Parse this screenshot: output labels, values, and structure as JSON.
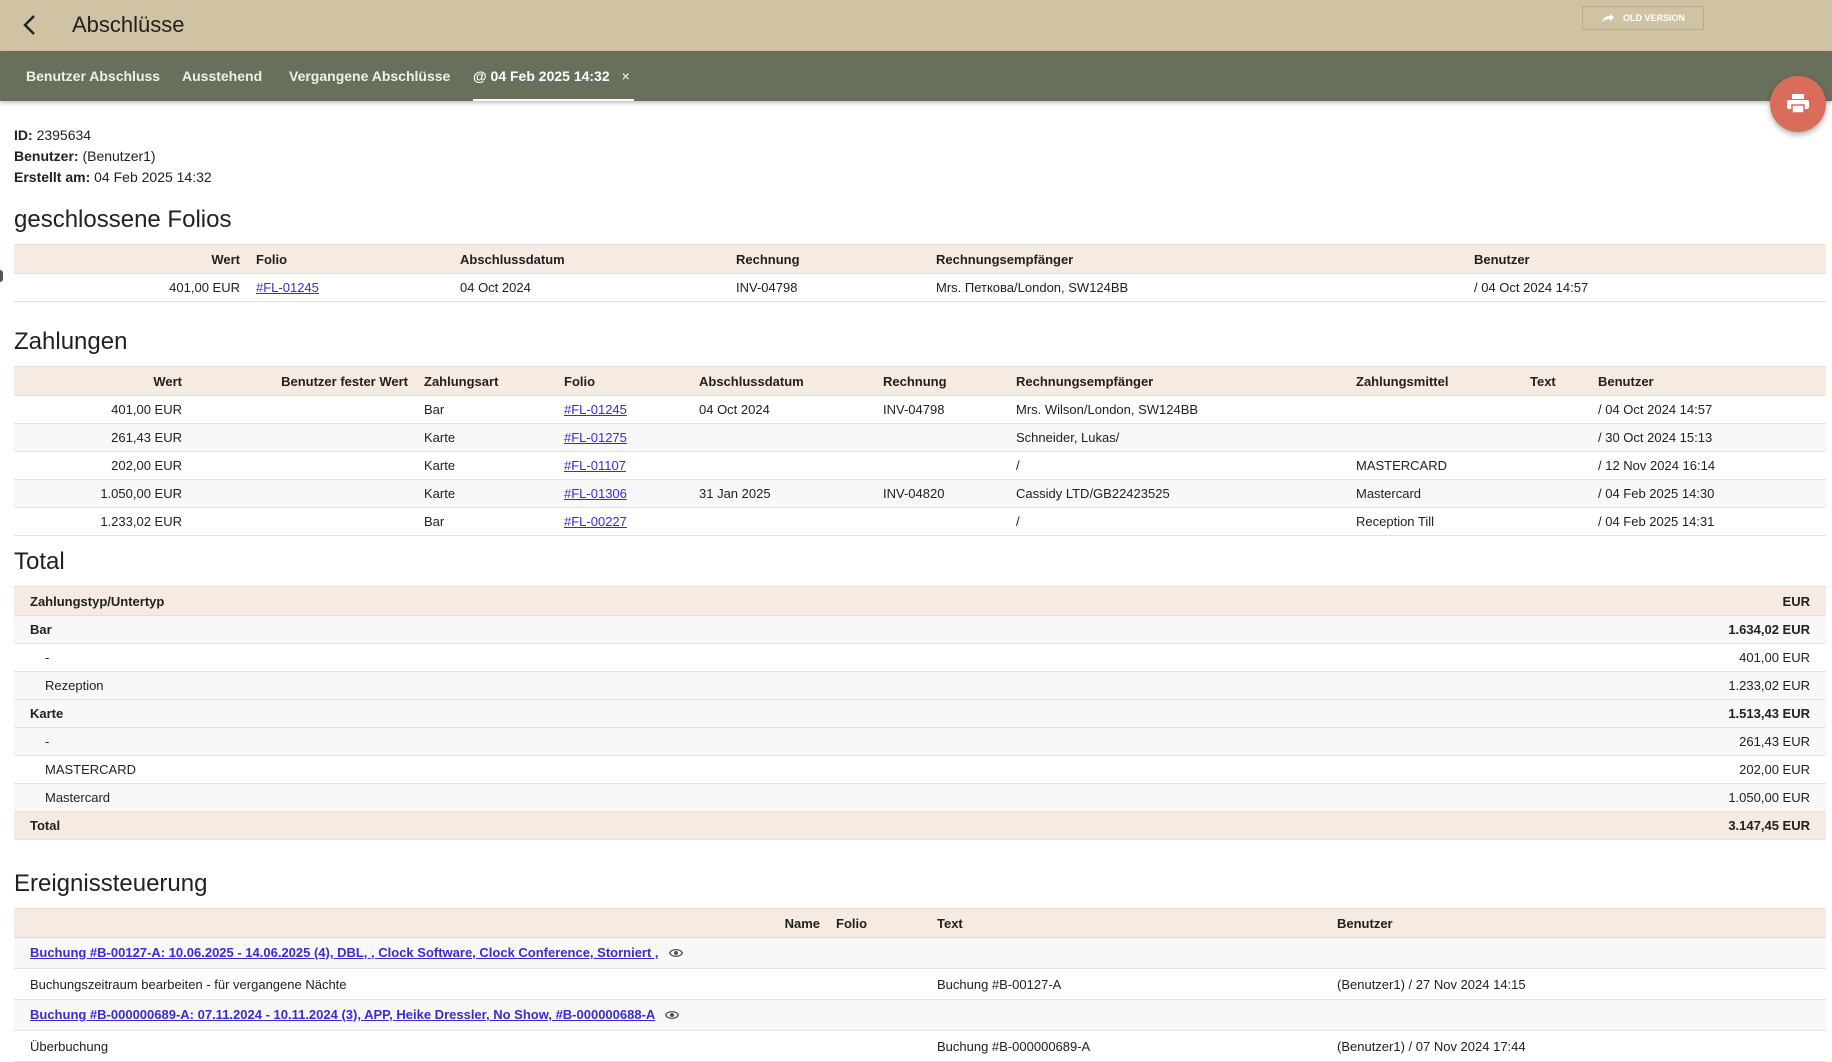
{
  "header": {
    "title": "Abschlüsse",
    "old_version": "OLD VERSION"
  },
  "tabs": [
    {
      "label": "Benutzer Abschluss"
    },
    {
      "label": "Ausstehend"
    },
    {
      "label": "Vergangene Abschlüsse"
    },
    {
      "label": "@ 04 Feb 2025 14:32",
      "close": "×"
    }
  ],
  "meta": {
    "id_label": "ID:",
    "id": "2395634",
    "user_label": "Benutzer:",
    "user": "(Benutzer1)",
    "created_label": "Erstellt am:",
    "created": "04 Feb 2025 14:32"
  },
  "folios": {
    "title": "geschlossene Folios",
    "headers": [
      "Wert",
      "Folio",
      "Abschlussdatum",
      "Rechnung",
      "Rechnungsempfänger",
      "Benutzer"
    ],
    "rows": [
      [
        "401,00 EUR",
        "#FL-01245",
        "04 Oct 2024",
        "INV-04798",
        "Mrs. Петкова/London, SW124BB",
        "/ 04 Oct 2024 14:57"
      ]
    ]
  },
  "payments": {
    "title": "Zahlungen",
    "headers": [
      "Wert",
      "Benutzer fester Wert",
      "Zahlungsart",
      "Folio",
      "Abschlussdatum",
      "Rechnung",
      "Rechnungsempfänger",
      "Zahlungsmittel",
      "Text",
      "Benutzer"
    ],
    "rows": [
      [
        "401,00 EUR",
        "",
        "Bar",
        "#FL-01245",
        "04 Oct 2024",
        "INV-04798",
        "Mrs. Wilson/London, SW124BB",
        "",
        "",
        "/ 04 Oct 2024 14:57"
      ],
      [
        "261,43 EUR",
        "",
        "Karte",
        "#FL-01275",
        "",
        "",
        "Schneider, Lukas/",
        "",
        "",
        "/ 30 Oct 2024 15:13"
      ],
      [
        "202,00 EUR",
        "",
        "Karte",
        "#FL-01107",
        "",
        "",
        "/",
        "MASTERCARD",
        "",
        "/ 12 Nov 2024 16:14"
      ],
      [
        "1.050,00 EUR",
        "",
        "Karte",
        "#FL-01306",
        "31 Jan 2025",
        "INV-04820",
        "Cassidy LTD/GB22423525",
        "Mastercard",
        "",
        "/ 04 Feb 2025 14:30"
      ],
      [
        "1.233,02 EUR",
        "",
        "Bar",
        "#FL-00227",
        "",
        "",
        "/",
        "Reception Till",
        "",
        "/ 04 Feb 2025 14:31"
      ]
    ]
  },
  "total": {
    "title": "Total",
    "headers": [
      "Zahlungstyp/Untertyp",
      "EUR"
    ],
    "rows": [
      {
        "label": "Bar",
        "value": "1.634,02 EUR",
        "kind": "group"
      },
      {
        "label": "-",
        "value": "401,00 EUR",
        "kind": "sub"
      },
      {
        "label": "Rezeption",
        "value": "1.233,02 EUR",
        "kind": "sub"
      },
      {
        "label": "Karte",
        "value": "1.513,43 EUR",
        "kind": "group"
      },
      {
        "label": "-",
        "value": "261,43 EUR",
        "kind": "sub"
      },
      {
        "label": "MASTERCARD",
        "value": "202,00 EUR",
        "kind": "sub"
      },
      {
        "label": "Mastercard",
        "value": "1.050,00 EUR",
        "kind": "sub"
      },
      {
        "label": "Total",
        "value": "3.147,45 EUR",
        "kind": "total"
      }
    ]
  },
  "events": {
    "title": "Ereignissteuerung",
    "headers": [
      "Name",
      "Folio",
      "Text",
      "Benutzer"
    ],
    "groups": [
      {
        "link": "Buchung #B-00127-A: 10.06.2025 - 14.06.2025 (4), DBL, , Clock Software, Clock Conference, Storniert ,",
        "name": "Buchungszeitraum bearbeiten - für vergangene Nächte",
        "text": "Buchung #B-00127-A",
        "user": "(Benutzer1) / 27 Nov 2024 14:15"
      },
      {
        "link": "Buchung #B-000000689-A: 07.11.2024 - 10.11.2024 (3), APP, Heike Dressler, No Show, #B-000000688-A",
        "name": "Überbuchung",
        "text": "Buchung #B-000000689-A",
        "user": "(Benutzer1) / 07 Nov 2024 17:44"
      }
    ]
  }
}
